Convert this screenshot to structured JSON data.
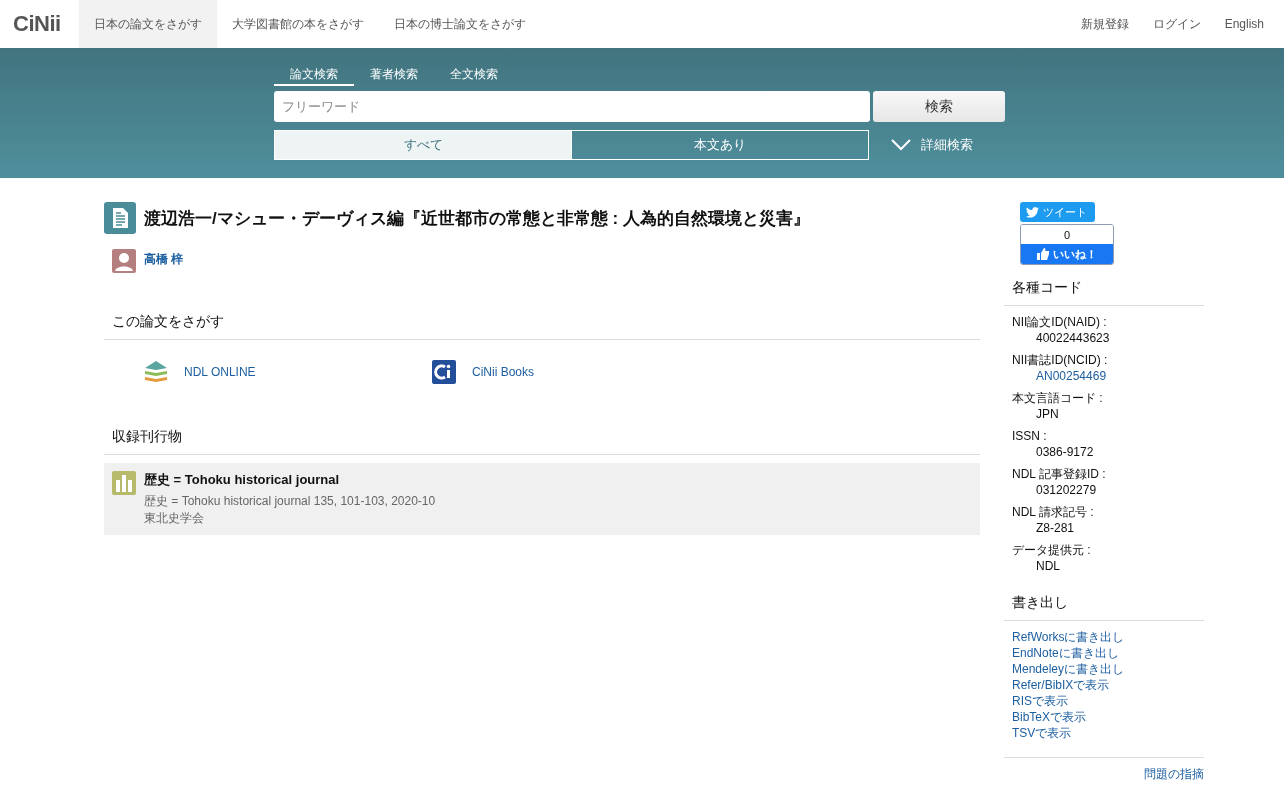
{
  "logo": "CiNii",
  "nav": {
    "items": [
      {
        "label": "日本の論文をさがす",
        "selected": true
      },
      {
        "label": "大学図書館の本をさがす",
        "selected": false
      },
      {
        "label": "日本の博士論文をさがす",
        "selected": false
      }
    ],
    "right": [
      "新規登録",
      "ログイン",
      "English"
    ]
  },
  "search": {
    "tabs": [
      {
        "label": "論文検索",
        "selected": true
      },
      {
        "label": "著者検索",
        "selected": false
      },
      {
        "label": "全文検索",
        "selected": false
      }
    ],
    "placeholder": "フリーワード",
    "button": "検索",
    "filters": [
      {
        "label": "すべて",
        "selected": true
      },
      {
        "label": "本文あり",
        "selected": false
      }
    ],
    "advanced": "詳細検索"
  },
  "article": {
    "title": "渡辺浩一/マシュー・デーヴィス編『近世都市の常態と非常態 : 人為的自然環境と災害』",
    "authors": [
      "高橋 梓"
    ],
    "find_heading": "この論文をさがす",
    "find_links": [
      {
        "kind": "ndl",
        "label": "NDL ONLINE"
      },
      {
        "kind": "cinii",
        "label": "CiNii Books"
      }
    ],
    "journal_heading": "収録刊行物",
    "journal": {
      "title": "歴史 = Tohoku historical journal",
      "citation": "歴史 = Tohoku historical journal 135, 101-103, 2020-10",
      "publisher": "東北史学会"
    }
  },
  "sidebar": {
    "tweet": "ツイート",
    "like_count": "0",
    "like": "いいね！",
    "codes_heading": "各種コード",
    "codes": [
      {
        "label": "NII論文ID(NAID) :",
        "value": "40022443623",
        "kind": "text"
      },
      {
        "label": "NII書誌ID(NCID) :",
        "value": "AN00254469",
        "kind": "link"
      },
      {
        "label": "本文言語コード :",
        "value": "JPN",
        "kind": "text"
      },
      {
        "label": "ISSN :",
        "value": "0386-9172",
        "kind": "text"
      },
      {
        "label": "NDL 記事登録ID :",
        "value": "031202279",
        "kind": "text"
      },
      {
        "label": "NDL 請求記号 :",
        "value": "Z8-281",
        "kind": "text"
      },
      {
        "label": "データ提供元 :",
        "value": "NDL",
        "kind": "text"
      }
    ],
    "export_heading": "書き出し",
    "exports": [
      "RefWorksに書き出し",
      "EndNoteに書き出し",
      "Mendeleyに書き出し",
      "Refer/BibIXで表示",
      "RISで表示",
      "BibTeXで表示",
      "TSVで表示"
    ],
    "report": "問題の指摘"
  }
}
